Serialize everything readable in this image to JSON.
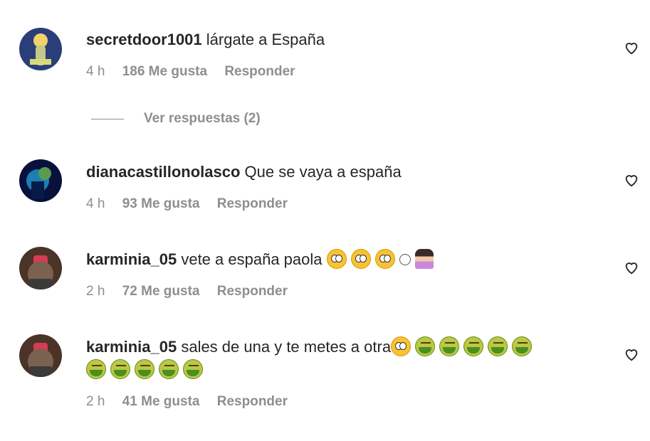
{
  "comments": [
    {
      "username": "secretdoor1001",
      "text": "lárgate a España",
      "time": "4 h",
      "likes": "186 Me gusta",
      "reply": "Responder",
      "view_replies": "Ver respuestas (2)"
    },
    {
      "username": "dianacastillonolasco",
      "text": "Que se vaya a españa",
      "time": "4 h",
      "likes": "93 Me gusta",
      "reply": "Responder"
    },
    {
      "username": "karminia_05",
      "text": "vete a españa paola",
      "emojis": [
        "face-with-rolling-eyes",
        "face-with-rolling-eyes",
        "face-with-rolling-eyes",
        "small-face",
        "woman-facepalming"
      ],
      "time": "2 h",
      "likes": "72 Me gusta",
      "reply": "Responder"
    },
    {
      "username": "karminia_05",
      "text": "sales de una y te metes a otra",
      "emojis": [
        "face-with-rolling-eyes",
        "nauseated-face",
        "nauseated-face",
        "nauseated-face",
        "nauseated-face",
        "nauseated-face",
        "nauseated-face",
        "nauseated-face",
        "nauseated-face",
        "nauseated-face",
        "nauseated-face"
      ],
      "time": "2 h",
      "likes": "41 Me gusta",
      "reply": "Responder"
    }
  ]
}
